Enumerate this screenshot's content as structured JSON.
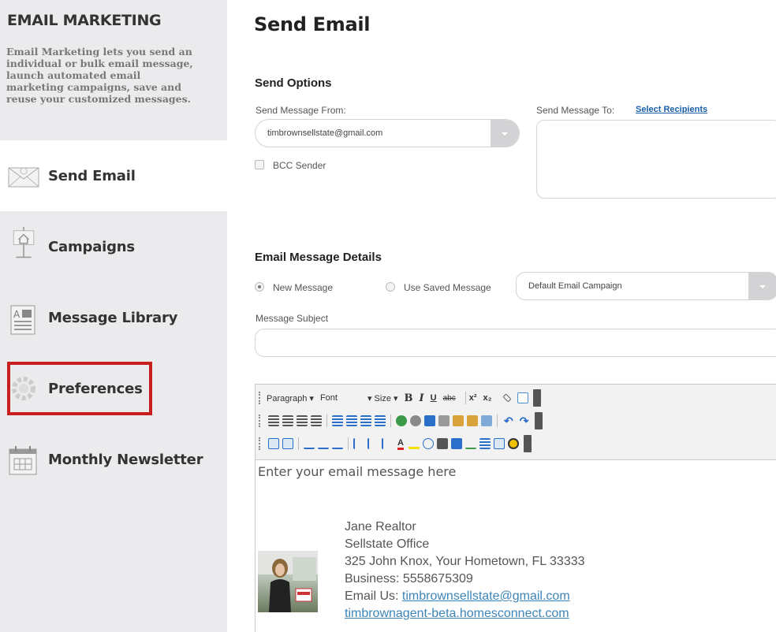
{
  "sidebar": {
    "title": "EMAIL MARKETING",
    "description": "Email Marketing lets you send an individual or bulk email message, launch automated email marketing campaigns, save and reuse your customized messages.",
    "items": [
      {
        "label": "Send Email",
        "icon": "envelope-icon",
        "active": true
      },
      {
        "label": "Campaigns",
        "icon": "house-sign-icon",
        "active": false
      },
      {
        "label": "Message Library",
        "icon": "library-icon",
        "active": false
      },
      {
        "label": "Preferences",
        "icon": "gear-icon",
        "active": false
      },
      {
        "label": "Monthly Newsletter",
        "icon": "calendar-icon",
        "active": false
      }
    ]
  },
  "main": {
    "title": "Send Email",
    "send_options": {
      "heading": "Send Options",
      "from_label": "Send Message From:",
      "from_value": "timbrownsellstate@gmail.com",
      "bcc_label": "BCC Sender",
      "to_label": "Send Message To:",
      "select_recipients": "Select Recipients"
    },
    "details": {
      "heading": "Email Message Details",
      "new_message": "New Message",
      "use_saved": "Use Saved Message",
      "saved_select": "Default Email Campaign",
      "subject_label": "Message Subject"
    },
    "editor": {
      "toolbar": {
        "paragraph": "Paragraph",
        "font": "Font",
        "size": "Size"
      },
      "placeholder": "Enter your email message here",
      "signature": {
        "name": "Jane Realtor",
        "office": "Sellstate Office",
        "address": "325 John Knox, Your Hometown, FL 33333",
        "business": "Business: 5558675309",
        "email_prefix": "Email Us: ",
        "email": "timbrownsellstate@gmail.com",
        "website": "timbrownagent-beta.homesconnect.com"
      }
    }
  },
  "colors": {
    "accent_link": "#1a5fa8",
    "highlight": "#c81e1e",
    "sidebar_bg": "#ebebed"
  }
}
